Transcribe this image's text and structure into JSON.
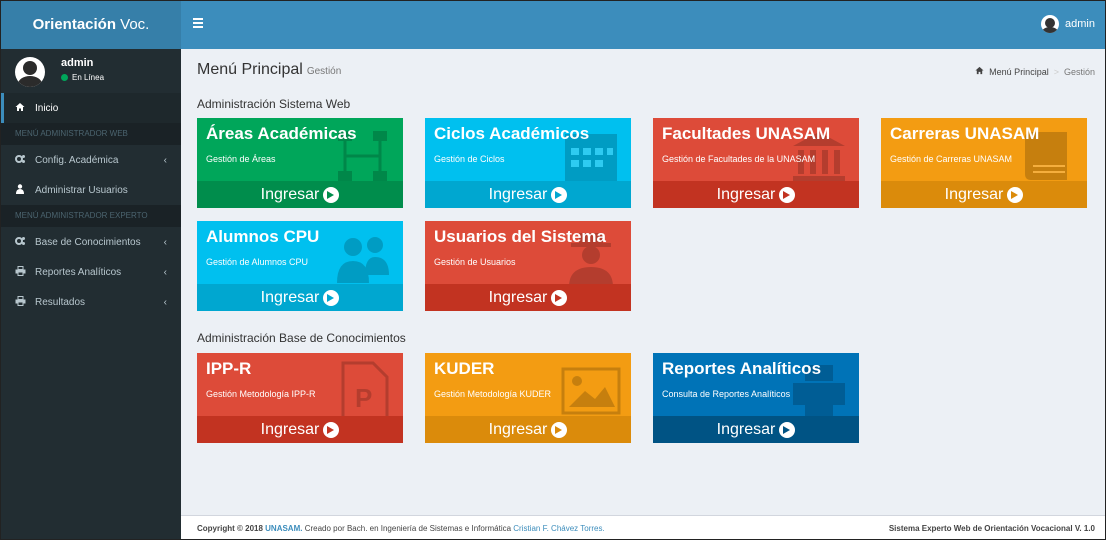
{
  "header": {
    "logo_bold": "Orientación",
    "logo_rest": " Voc.",
    "user": "admin"
  },
  "sidebar": {
    "user_name": "admin",
    "user_status": "En Línea",
    "items": [
      {
        "label": "Inicio",
        "icon": "home-icon"
      },
      {
        "label": "MENÚ ADMINISTRADOR WEB",
        "type": "header"
      },
      {
        "label": "Config. Académica",
        "icon": "cogs-icon"
      },
      {
        "label": "Administrar Usuarios",
        "icon": "users-icon"
      },
      {
        "label": "MENÚ ADMINISTRADOR EXPERTO",
        "type": "header"
      },
      {
        "label": "Base de Conocimientos",
        "icon": "cogs-icon"
      },
      {
        "label": "Reportes Analíticos",
        "icon": "print-icon"
      },
      {
        "label": "Resultados",
        "icon": "print-icon"
      }
    ]
  },
  "page": {
    "title": "Menú Principal",
    "subtitle": "Gestión",
    "breadcrumb": [
      "Menú Principal",
      "Gestión"
    ],
    "sections": [
      "Administración Sistema Web",
      "Administración Base de Conocimientos"
    ]
  },
  "tiles": [
    {
      "title": "Áreas Académicas",
      "desc": "Gestión de Áreas",
      "cta": "Ingresar",
      "color": "#00a65a"
    },
    {
      "title": "Ciclos Académicos",
      "desc": "Gestión de Ciclos",
      "cta": "Ingresar",
      "color": "#00c0ef"
    },
    {
      "title": "Facultades UNASAM",
      "desc": "Gestión de Facultades de la UNASAM",
      "cta": "Ingresar",
      "color": "#dd4b39"
    },
    {
      "title": "Carreras UNASAM",
      "desc": "Gestión de Carreras UNASAM",
      "cta": "Ingresar",
      "color": "#f39c12"
    },
    {
      "title": "Alumnos CPU",
      "desc": "Gestión de Alumnos CPU",
      "cta": "Ingresar",
      "color": "#00c0ef"
    },
    {
      "title": "Usuarios del Sistema",
      "desc": "Gestión de Usuarios",
      "cta": "Ingresar",
      "color": "#dd4b39"
    },
    {
      "title": "IPP-R",
      "desc": "Gestión Metodología IPP-R",
      "cta": "Ingresar",
      "color": "#dd4b39"
    },
    {
      "title": "KUDER",
      "desc": "Gestión Metodología KUDER",
      "cta": "Ingresar",
      "color": "#f39c12"
    },
    {
      "title": "Reportes Analíticos",
      "desc": "Consulta de Reportes Analíticos",
      "cta": "Ingresar",
      "color": "#0073b7"
    }
  ],
  "footer": {
    "copy": "Copyright © 2018 ",
    "org": "UNASAM.",
    "mid": " Creado por Bach. en Ingeniería de Sistemas e Informática ",
    "author": "Cristian F. Chávez Torres.",
    "version": "Sistema Experto Web de Orientación Vocacional V. 1.0"
  }
}
